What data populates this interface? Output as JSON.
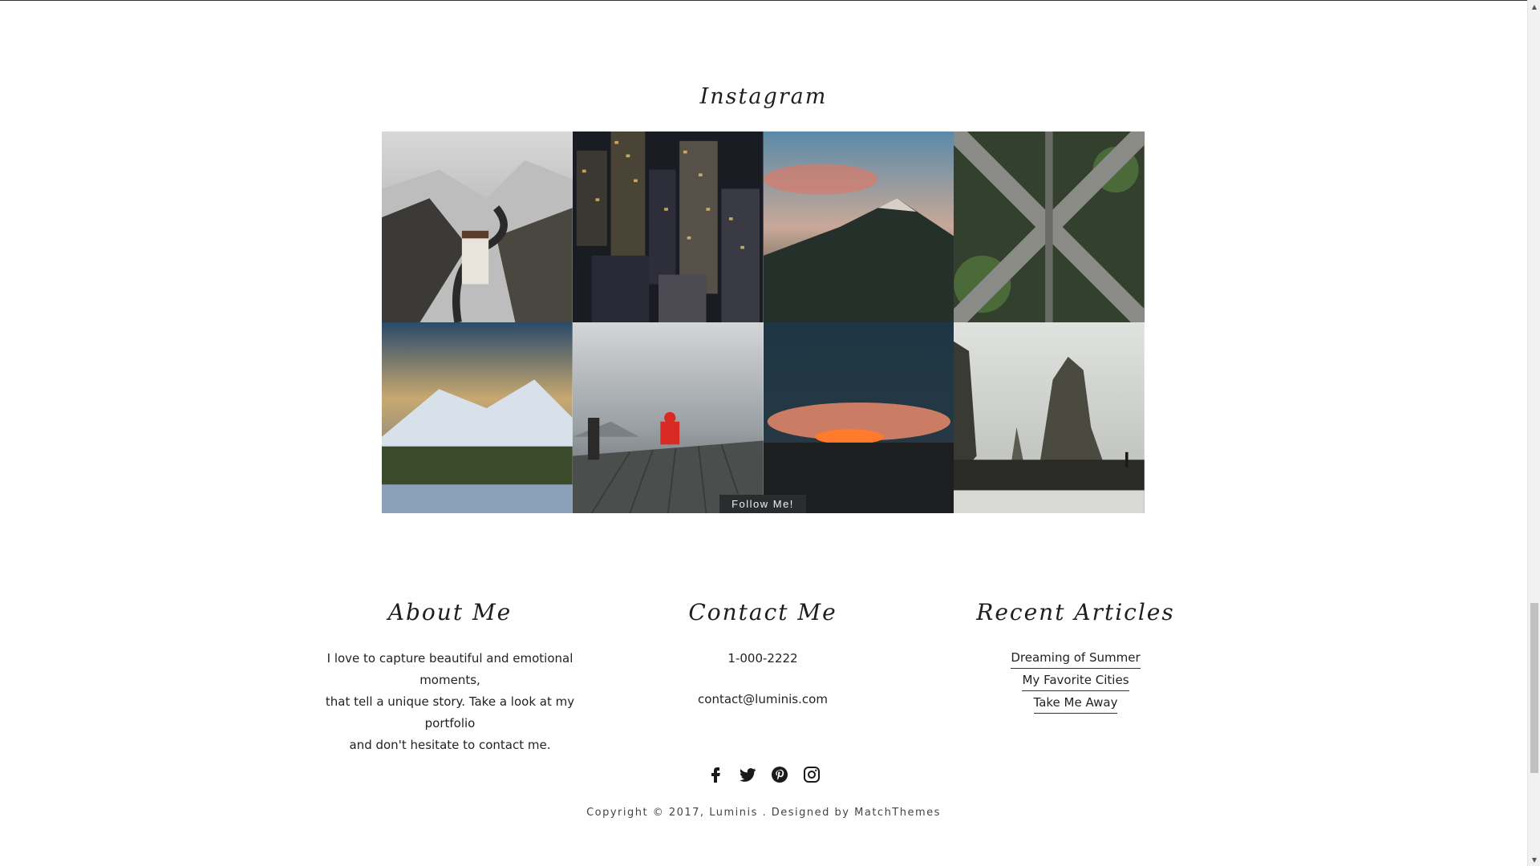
{
  "instagram": {
    "title": "Instagram",
    "follow_label": "Follow Me!",
    "images": [
      {
        "alt": "mountain road hotel"
      },
      {
        "alt": "city skyscrapers at night"
      },
      {
        "alt": "volcano at dusk"
      },
      {
        "alt": "highway interchange aerial"
      },
      {
        "alt": "snowy mountain and lake"
      },
      {
        "alt": "person on pier in fog"
      },
      {
        "alt": "lava glow at night"
      },
      {
        "alt": "sea stacks on beach"
      }
    ]
  },
  "about": {
    "title": "About Me",
    "text_lines": [
      "I love to capture beautiful and emotional moments,",
      "that tell a unique story. Take a look at my portfolio",
      "and don't hesitate to contact me."
    ]
  },
  "contact": {
    "title": "Contact Me",
    "phone": "1-000-2222",
    "email": "contact@luminis.com"
  },
  "recent": {
    "title": "Recent Articles",
    "articles": [
      "Dreaming of Summer",
      "My Favorite Cities",
      "Take Me Away"
    ]
  },
  "social": {
    "icons": [
      "facebook-icon",
      "twitter-icon",
      "pinterest-icon",
      "instagram-icon"
    ]
  },
  "footer": {
    "copyright_prefix": "Copyright © 2017,",
    "site_name": "Luminis",
    "designed_by": ". Designed by",
    "designer": "MatchThemes"
  },
  "scrollbar": {
    "position_fraction": 0.88
  }
}
